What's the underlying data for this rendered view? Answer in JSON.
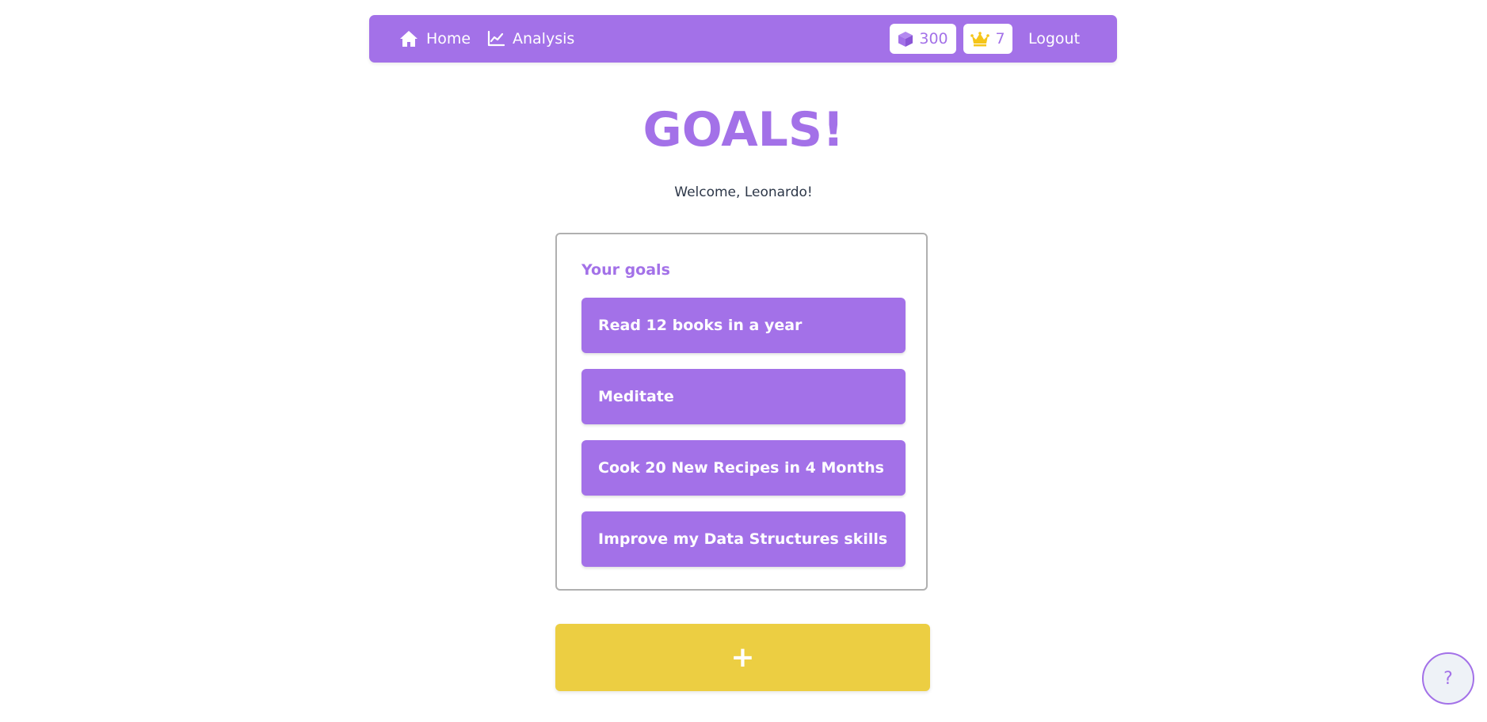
{
  "navbar": {
    "home_label": "Home",
    "home_icon": "home-icon",
    "analysis_label": "Analysis",
    "analysis_icon": "chart-line-icon",
    "gems_count": "300",
    "gems_icon": "cube-icon",
    "crowns_count": "7",
    "crowns_icon": "crown-icon",
    "logout_label": "Logout"
  },
  "page": {
    "title": "GOALS!",
    "welcome": "Welcome, Leonardo!"
  },
  "goals": {
    "heading": "Your goals",
    "items": [
      {
        "label": "Read 12 books in a year"
      },
      {
        "label": "Meditate"
      },
      {
        "label": "Cook 20 New Recipes in 4 Months"
      },
      {
        "label": "Improve my Data Structures skills"
      }
    ]
  },
  "actions": {
    "add_label": "+",
    "help_label": "?"
  },
  "colors": {
    "primary": "#a371e8",
    "accent": "#ecce42",
    "crown": "#f5c518"
  }
}
